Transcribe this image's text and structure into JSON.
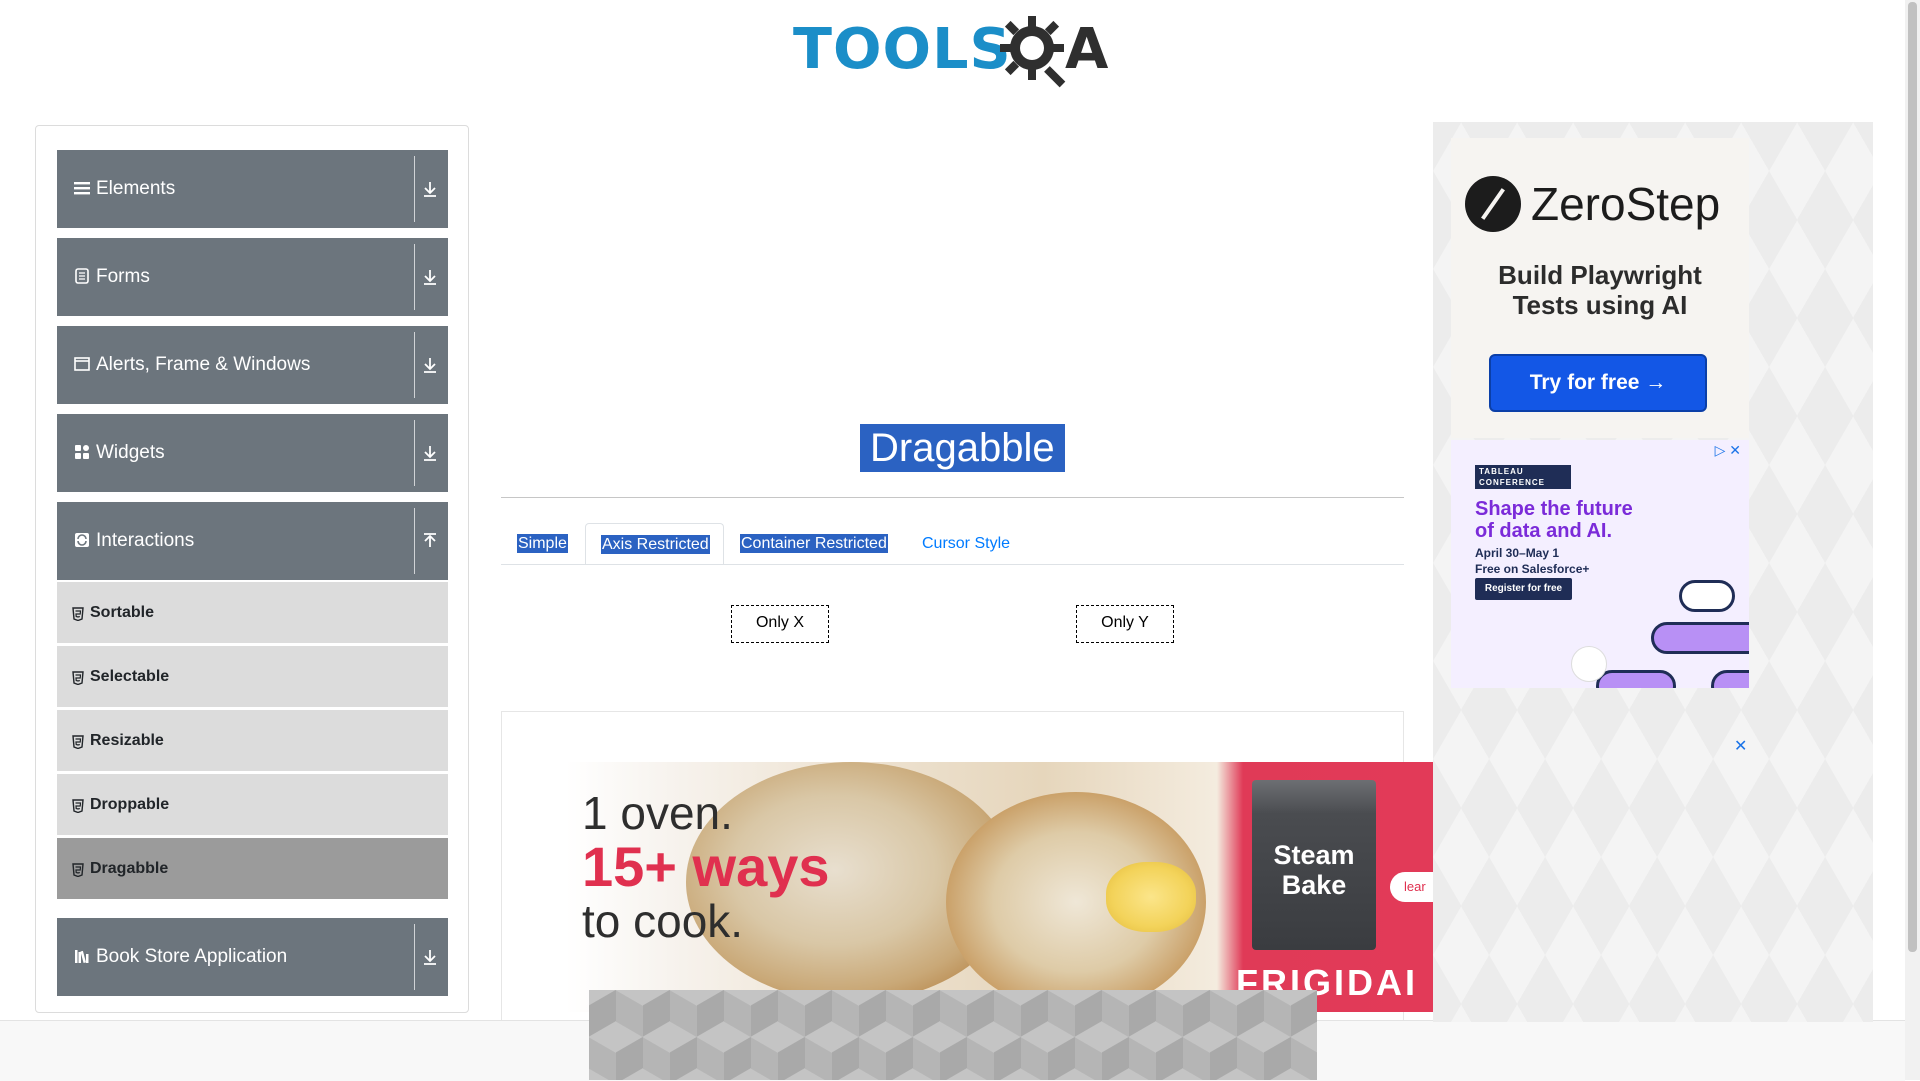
{
  "header": {
    "logo_text_left": "TOOLS",
    "logo_text_right": "A",
    "logo_brand_color": "#1b8ec8"
  },
  "sidebar": {
    "groups": [
      {
        "label": "Elements",
        "icon": "hamburger-icon",
        "expanded": false
      },
      {
        "label": "Forms",
        "icon": "form-icon",
        "expanded": false
      },
      {
        "label": "Alerts, Frame & Windows",
        "icon": "window-icon",
        "expanded": false
      },
      {
        "label": "Widgets",
        "icon": "widgets-icon",
        "expanded": false
      },
      {
        "label": "Interactions",
        "icon": "interactions-icon",
        "expanded": true
      },
      {
        "label": "Book Store Application",
        "icon": "books-icon",
        "expanded": false
      }
    ],
    "interactions_items": [
      {
        "label": "Sortable",
        "active": false
      },
      {
        "label": "Selectable",
        "active": false
      },
      {
        "label": "Resizable",
        "active": false
      },
      {
        "label": "Droppable",
        "active": false
      },
      {
        "label": "Dragabble",
        "active": true
      }
    ]
  },
  "main": {
    "title": "Dragabble",
    "tabs": [
      {
        "label": "Simple",
        "selected_text": true,
        "active": false
      },
      {
        "label": "Axis Restricted",
        "selected_text": true,
        "active": true
      },
      {
        "label": "Container Restricted",
        "selected_text": true,
        "active": false
      },
      {
        "label": "Cursor Style",
        "selected_text": false,
        "active": false
      }
    ],
    "only_x": "Only X",
    "only_y": "Only Y"
  },
  "ads": {
    "oven": {
      "line1": "1 oven.",
      "line2": "15+ ways",
      "line3": "to cook.",
      "steam": "Steam",
      "bake": "Bake",
      "brand": "FRIGIDAI",
      "learn": "lear"
    },
    "zerostep": {
      "brand": "ZeroStep",
      "tagline_1": "Build Playwright",
      "tagline_2": "Tests using AI",
      "button": "Try for free →"
    },
    "tableau": {
      "brand_1": "TABLEAU",
      "brand_2": "CONFERENCE",
      "headline_1": "Shape the future",
      "headline_2": "of data and AI.",
      "dates": "April 30–May 1",
      "free": "Free on Salesforce+",
      "button": "Register for free",
      "adchoice": "▷ ✕"
    },
    "close_label": "✕"
  },
  "colors": {
    "sidebar_header": "#6c757d",
    "sidebar_item": "#dcdcdc",
    "sidebar_item_active": "#9b9b9b",
    "text_selection": "#2b62c2",
    "link": "#007bff"
  }
}
